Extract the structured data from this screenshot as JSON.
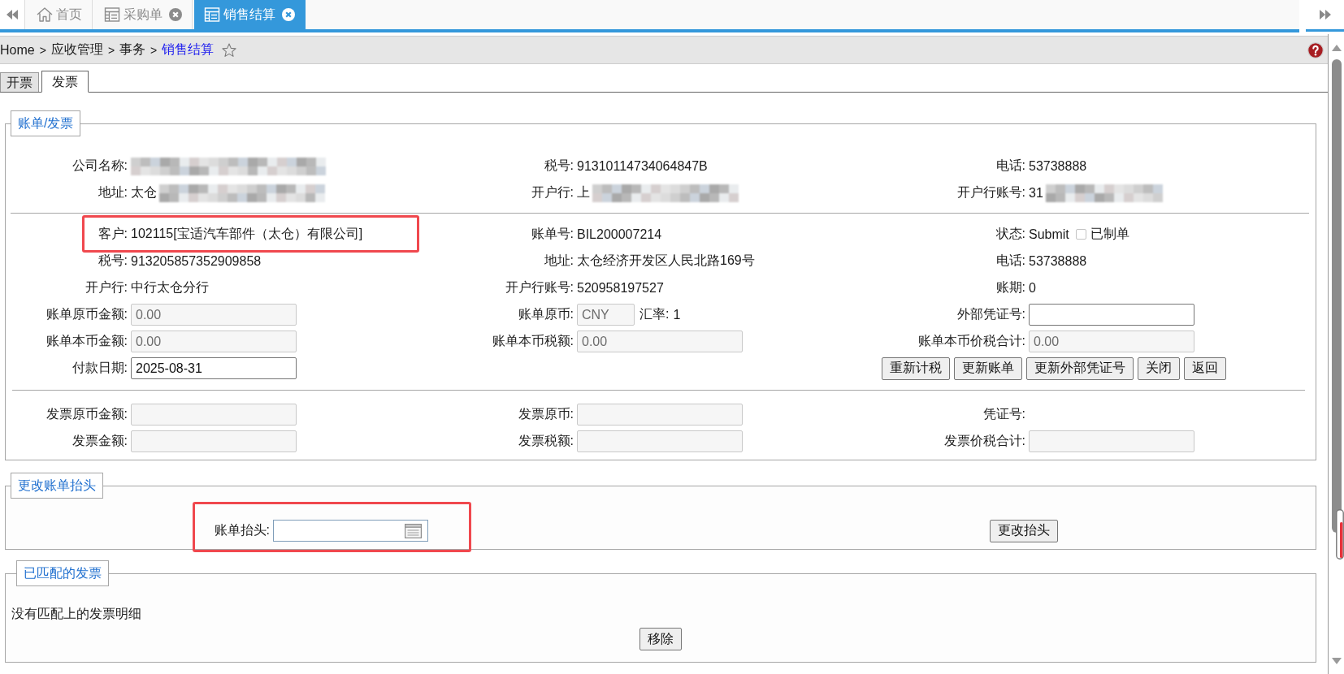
{
  "app_tabs": [
    {
      "kind": "home",
      "label": "首页",
      "closable": false,
      "selected": false
    },
    {
      "kind": "page",
      "label": "采购单",
      "closable": true,
      "selected": false
    },
    {
      "kind": "page",
      "label": "销售结算",
      "closable": true,
      "selected": true
    }
  ],
  "breadcrumb": {
    "items": [
      {
        "label": "Home",
        "separator": ">",
        "current": false
      },
      {
        "label": "应收管理",
        "separator": ">",
        "current": false
      },
      {
        "label": "事务",
        "separator": ">",
        "current": false
      },
      {
        "label": "销售结算",
        "current": true
      }
    ],
    "favorite": false
  },
  "page_tabs": [
    {
      "label": "开票",
      "selected": false
    },
    {
      "label": "发票",
      "selected": true
    }
  ],
  "sections": [
    {
      "kind": "form",
      "legend": "账单/发票",
      "groups": [
        {
          "rows": [
            {
              "cells": [
                {
                  "kind": "text",
                  "label": "公司名称:",
                  "redacted": true
                },
                {
                  "kind": "text",
                  "label": "税号:",
                  "value": "91310114734064847B"
                },
                {
                  "kind": "text",
                  "label": "电话:",
                  "value": "53738888"
                }
              ]
            },
            {
              "cells": [
                {
                  "kind": "text",
                  "label": "地址:",
                  "value": "太仓",
                  "redacted": true
                },
                {
                  "kind": "text",
                  "label": "开户行:",
                  "value": "上",
                  "redacted": true
                },
                {
                  "kind": "text",
                  "label": "开户行账号:",
                  "value": "31",
                  "redacted": true
                }
              ]
            }
          ]
        },
        {
          "rows": [
            {
              "cells": [
                {
                  "kind": "text",
                  "label": "客户:",
                  "value": "102115[宝适汽车部件（太仓）有限公司]",
                  "highlighted": true
                },
                {
                  "kind": "text",
                  "label": "账单号:",
                  "value": "BIL200007214"
                },
                {
                  "kind": "status",
                  "label": "状态:",
                  "value": "Submit",
                  "checkbox": {
                    "label": "已制单",
                    "checked": false
                  }
                }
              ]
            },
            {
              "cells": [
                {
                  "kind": "text",
                  "label": "税号:",
                  "value": "913205857352909858"
                },
                {
                  "kind": "text",
                  "label": "地址:",
                  "value": "太仓经济开发区人民北路169号"
                },
                {
                  "kind": "text",
                  "label": "电话:",
                  "value": "53738888"
                }
              ]
            },
            {
              "cells": [
                {
                  "kind": "text",
                  "label": "开户行:",
                  "value": "中行太仓分行"
                },
                {
                  "kind": "text",
                  "label": "开户行账号:",
                  "value": "520958197527"
                },
                {
                  "kind": "text",
                  "label": "账期:",
                  "value": "0"
                }
              ]
            },
            {
              "cells": [
                {
                  "kind": "input",
                  "label": "账单原币金额:",
                  "value": "0.00",
                  "disabled": true
                },
                {
                  "kind": "currency",
                  "label": "账单原币:",
                  "input": {
                    "value": "CNY",
                    "disabled": true
                  },
                  "rate_label": "汇率:",
                  "rate_value": "1"
                },
                {
                  "kind": "input",
                  "label": "外部凭证号:",
                  "disabled": false
                }
              ]
            },
            {
              "cells": [
                {
                  "kind": "input",
                  "label": "账单本币金额:",
                  "value": "0.00",
                  "disabled": true
                },
                {
                  "kind": "input",
                  "label": "账单本币税额:",
                  "value": "0.00",
                  "disabled": true
                },
                {
                  "kind": "input",
                  "label": "账单本币价税合计:",
                  "value": "0.00",
                  "disabled": true
                }
              ]
            },
            {
              "cells": [
                {
                  "kind": "input",
                  "label": "付款日期:",
                  "value": "2025-08-31",
                  "disabled": false
                },
                "",
                {
                  "kind": "buttons",
                  "buttons": [
                    "重新计税",
                    "更新账单",
                    "更新外部凭证号",
                    "关闭",
                    "返回"
                  ]
                }
              ]
            }
          ]
        },
        {
          "rows": [
            {
              "cells": [
                {
                  "kind": "input",
                  "label": "发票原币金额:",
                  "disabled": true
                },
                {
                  "kind": "input",
                  "label": "发票原币:",
                  "disabled": true
                },
                {
                  "kind": "text",
                  "label": "凭证号:"
                }
              ]
            },
            {
              "cells": [
                {
                  "kind": "input",
                  "label": "发票金额:",
                  "disabled": true
                },
                {
                  "kind": "input",
                  "label": "发票税额:",
                  "disabled": true
                },
                {
                  "kind": "input",
                  "label": "发票价税合计:",
                  "disabled": true
                }
              ]
            }
          ]
        }
      ]
    },
    {
      "kind": "header-change",
      "legend": "更改账单抬头",
      "field": {
        "label": "账单抬头:",
        "highlighted": true
      },
      "button": "更改抬头"
    },
    {
      "kind": "matched",
      "legend": "已匹配的发票",
      "message": "没有匹配上的发票明细",
      "button": "移除"
    }
  ]
}
